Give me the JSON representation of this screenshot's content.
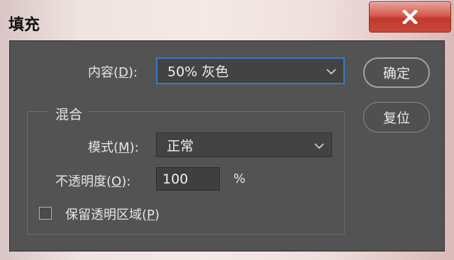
{
  "window": {
    "title": "填充"
  },
  "content": {
    "label_prefix": "内容(",
    "label_key": "D",
    "label_suffix": "):",
    "value": "50% 灰色"
  },
  "buttons": {
    "ok": "确定",
    "reset": "复位"
  },
  "blend": {
    "group_title": "混合",
    "mode": {
      "label_prefix": "模式(",
      "label_key": "M",
      "label_suffix": "):",
      "value": "正常"
    },
    "opacity": {
      "label_prefix": "不透明度(",
      "label_key": "O",
      "label_suffix": "):",
      "value": "100",
      "unit": "%"
    },
    "preserve": {
      "label_prefix": "保留透明区域(",
      "label_key": "P",
      "label_suffix": ")",
      "checked": false
    }
  },
  "icons": {
    "close": "close-icon",
    "dropdown": "chevron-down-icon"
  }
}
